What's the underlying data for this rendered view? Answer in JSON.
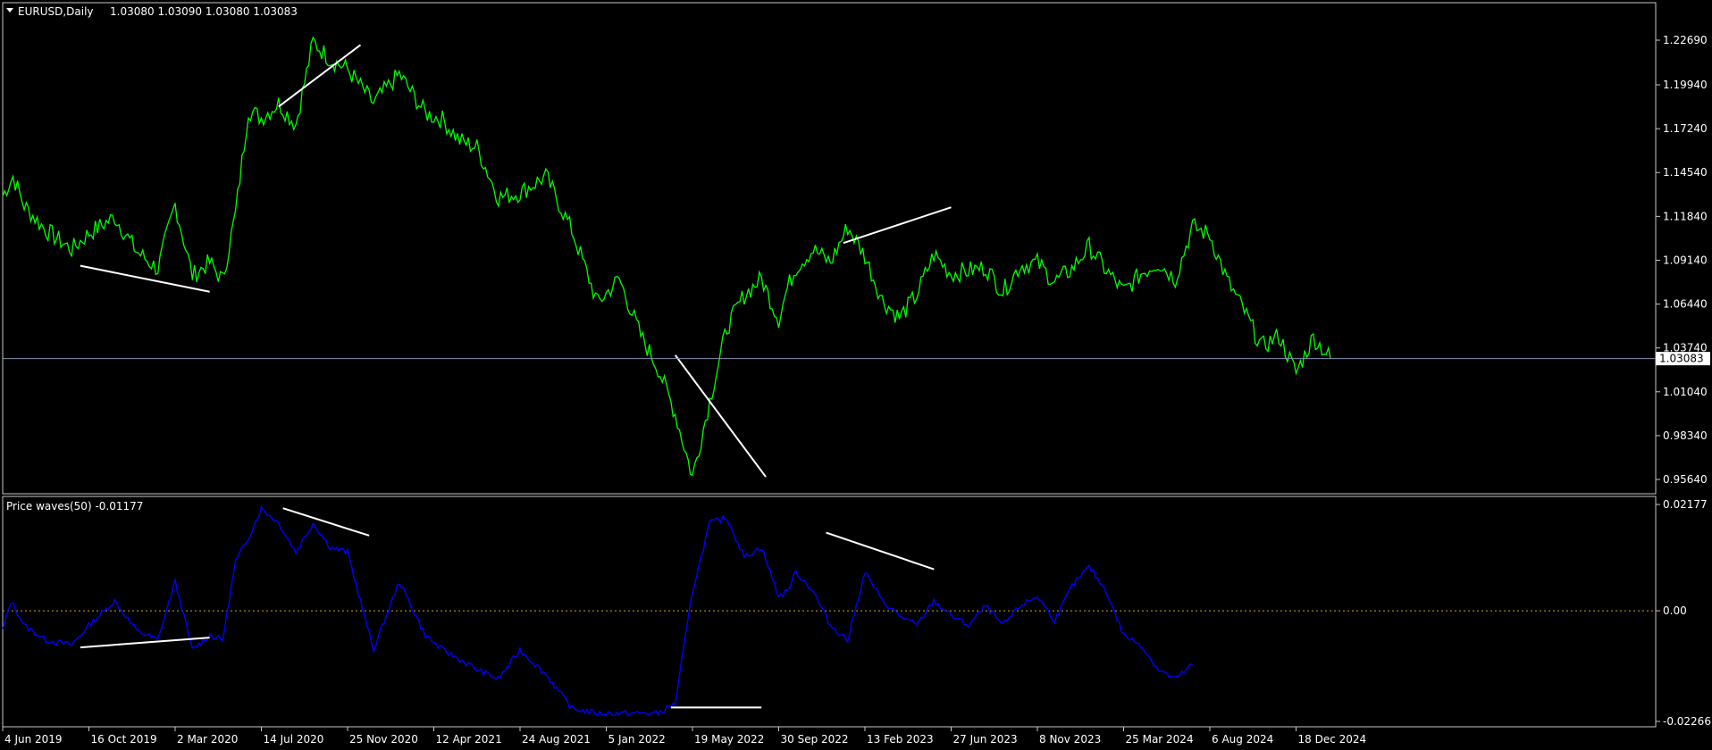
{
  "header": {
    "symbol_label": "EURUSD,Daily",
    "ohlc": "1.03080 1.03090 1.03080 1.03083",
    "indicator_label": "Price waves(50) -0.01177"
  },
  "colors": {
    "background": "#000000",
    "frame": "#c8c8c8",
    "price": "#00ff00",
    "indicator": "#0000ff",
    "trendline": "#ffffff",
    "zero_line": "#daa520",
    "current_price_line": "#8891b0"
  },
  "chart_data": [
    {
      "type": "line",
      "name": "price",
      "ylim": [
        0.9564,
        1.2269
      ],
      "yticks": [
        "1.22690",
        "1.19940",
        "1.17240",
        "1.14540",
        "1.11840",
        "1.09140",
        "1.06440",
        "1.03740",
        "1.01040",
        "0.98340",
        "0.95640"
      ],
      "current_value": "1.03083",
      "x_ticks": [
        "4 Jun 2019",
        "16 Oct 2019",
        "2 Mar 2020",
        "14 Jul 2020",
        "25 Nov 2020",
        "12 Apr 2021",
        "24 Aug 2021",
        "5 Jan 2022",
        "19 May 2022",
        "30 Sep 2022",
        "13 Feb 2023",
        "27 Jun 2023",
        "8 Nov 2023",
        "25 Mar 2024",
        "6 Aug 2024",
        "18 Dec 2024"
      ],
      "x": [
        0,
        0.12,
        0.25,
        0.5,
        0.8,
        1.0,
        1.3,
        1.55,
        1.8,
        2.0,
        2.2,
        2.4,
        2.55,
        2.7,
        2.85,
        3.0,
        3.2,
        3.4,
        3.6,
        3.8,
        4.0,
        4.3,
        4.6,
        4.9,
        5.1,
        5.3,
        5.5,
        5.75,
        6.0,
        6.3,
        6.6,
        6.9,
        7.15,
        7.4,
        7.6,
        7.8,
        8.0,
        8.2,
        8.4,
        8.6,
        8.8,
        9.0,
        9.1,
        9.2,
        9.4,
        9.6,
        9.8,
        10.0,
        10.2,
        10.4,
        10.6,
        10.8,
        11.0,
        11.2,
        11.4,
        11.6,
        11.8,
        12.0,
        12.2,
        12.4,
        12.6,
        12.8,
        13.0,
        13.2,
        13.4,
        13.6,
        13.8,
        14.0,
        14.2,
        14.4,
        14.6,
        14.8,
        15.0,
        15.2,
        15.4
      ],
      "values": [
        1.131,
        1.143,
        1.125,
        1.11,
        1.098,
        1.108,
        1.118,
        1.097,
        1.086,
        1.126,
        1.082,
        1.09,
        1.079,
        1.12,
        1.184,
        1.179,
        1.188,
        1.175,
        1.226,
        1.215,
        1.209,
        1.188,
        1.206,
        1.182,
        1.178,
        1.165,
        1.161,
        1.13,
        1.133,
        1.143,
        1.11,
        1.065,
        1.08,
        1.045,
        1.025,
        0.997,
        0.958,
        1.005,
        1.05,
        1.07,
        1.08,
        1.055,
        1.074,
        1.087,
        1.098,
        1.09,
        1.112,
        1.094,
        1.067,
        1.056,
        1.07,
        1.095,
        1.083,
        1.085,
        1.087,
        1.072,
        1.088,
        1.09,
        1.078,
        1.086,
        1.1,
        1.085,
        1.072,
        1.083,
        1.09,
        1.08,
        1.112,
        1.107,
        1.079,
        1.06,
        1.038,
        1.045,
        1.022,
        1.044,
        1.031
      ],
      "trendlines": [
        {
          "x1": 0.9,
          "y1": 1.088,
          "x2": 2.4,
          "y2": 1.072
        },
        {
          "x1": 3.2,
          "y1": 1.186,
          "x2": 4.15,
          "y2": 1.224
        },
        {
          "x1": 7.8,
          "y1": 1.033,
          "x2": 8.85,
          "y2": 0.958
        },
        {
          "x1": 9.75,
          "y1": 1.102,
          "x2": 11.0,
          "y2": 1.124
        }
      ]
    },
    {
      "type": "line",
      "name": "indicator",
      "ylim": [
        -0.02266,
        0.02177
      ],
      "yticks": [
        "0.02177",
        "0.00",
        "-0.02266"
      ],
      "x": [
        0,
        0.1,
        0.25,
        0.5,
        0.8,
        1.0,
        1.3,
        1.55,
        1.8,
        2.0,
        2.2,
        2.4,
        2.55,
        2.7,
        2.85,
        3.0,
        3.2,
        3.4,
        3.6,
        3.8,
        4.0,
        4.3,
        4.6,
        4.9,
        5.1,
        5.3,
        5.5,
        5.75,
        6.0,
        6.3,
        6.6,
        6.9,
        7.15,
        7.4,
        7.6,
        7.8,
        8.0,
        8.2,
        8.4,
        8.6,
        8.8,
        9.0,
        9.1,
        9.2,
        9.4,
        9.6,
        9.8,
        10.0,
        10.2,
        10.4,
        10.6,
        10.8,
        11.0,
        11.2,
        11.4,
        11.6,
        11.8,
        12.0,
        12.2,
        12.4,
        12.6,
        12.8,
        13.0,
        13.2,
        13.4,
        13.6,
        13.8,
        14.0,
        14.2,
        14.4,
        14.6,
        14.8,
        15.0,
        15.2,
        15.4
      ],
      "values": [
        -0.004,
        0.002,
        -0.003,
        -0.006,
        -0.007,
        -0.003,
        0.002,
        -0.004,
        -0.006,
        0.006,
        -0.008,
        -0.005,
        -0.006,
        0.01,
        0.015,
        0.021,
        0.018,
        0.012,
        0.018,
        0.013,
        0.012,
        -0.008,
        0.006,
        -0.005,
        -0.008,
        -0.01,
        -0.012,
        -0.014,
        -0.008,
        -0.013,
        -0.02,
        -0.021,
        -0.021,
        -0.021,
        -0.021,
        -0.019,
        0.004,
        0.018,
        0.019,
        0.011,
        0.013,
        0.003,
        0.004,
        0.008,
        0.004,
        -0.003,
        -0.006,
        0.008,
        0.002,
        -0.001,
        -0.003,
        0.002,
        -0.001,
        -0.003,
        0.001,
        -0.003,
        0.001,
        0.003,
        -0.002,
        0.005,
        0.009,
        0.004,
        -0.005,
        -0.007,
        -0.012,
        -0.014,
        -0.011
      ],
      "trendlines": [
        {
          "x1": 0.9,
          "y1": -0.0075,
          "x2": 2.4,
          "y2": -0.0055
        },
        {
          "x1": 3.25,
          "y1": 0.021,
          "x2": 4.25,
          "y2": 0.0154
        },
        {
          "x1": 7.75,
          "y1": -0.0198,
          "x2": 8.8,
          "y2": -0.0198
        },
        {
          "x1": 9.55,
          "y1": 0.016,
          "x2": 10.8,
          "y2": 0.0085
        }
      ]
    }
  ]
}
